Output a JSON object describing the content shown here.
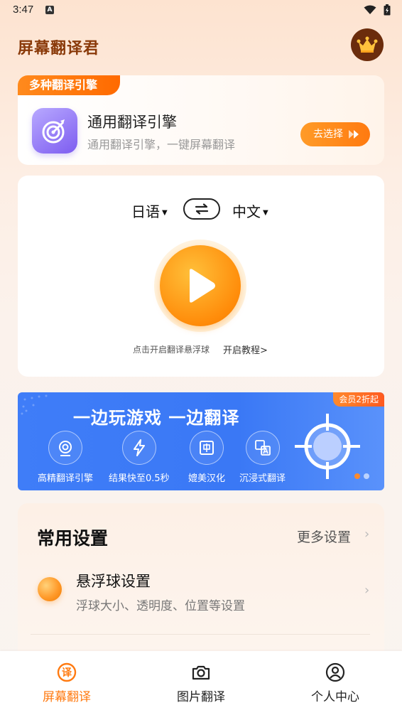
{
  "status_bar": {
    "time": "3:47",
    "notification": "A"
  },
  "header": {
    "title": "屏幕翻译君",
    "vip_icon": "crown-icon"
  },
  "engine_card": {
    "tag": "多种翻译引擎",
    "name": "通用翻译引擎",
    "description": "通用翻译引擎，一键屏幕翻译",
    "select_label": "去选择",
    "icon": "target-icon"
  },
  "translate": {
    "source_lang": "日语",
    "target_lang": "中文",
    "hint": "点击开启翻译悬浮球",
    "tutorial_link": "开启教程>"
  },
  "banner": {
    "badge": "会员2折起",
    "title": "一边玩游戏 一边翻译",
    "features": [
      {
        "label": "高精翻译引擎",
        "icon": "precision-icon"
      },
      {
        "label": "结果快至0.5秒",
        "icon": "lightning-icon"
      },
      {
        "label": "媲美汉化",
        "icon": "chinese-icon"
      },
      {
        "label": "沉浸式翻译",
        "icon": "translate-icon"
      }
    ]
  },
  "settings": {
    "title": "常用设置",
    "more": "更多设置",
    "items": [
      {
        "title": "悬浮球设置",
        "description": "浮球大小、透明度、位置等设置"
      }
    ]
  },
  "bottom_nav": {
    "items": [
      {
        "label": "屏幕翻译",
        "icon": "translate-circle-icon",
        "active": true
      },
      {
        "label": "图片翻译",
        "icon": "camera-icon",
        "active": false
      },
      {
        "label": "个人中心",
        "icon": "user-icon",
        "active": false
      }
    ]
  },
  "colors": {
    "accent": "#ff7a10",
    "banner_blue": "#3f7df8",
    "title_brown": "#8a3a0a"
  }
}
